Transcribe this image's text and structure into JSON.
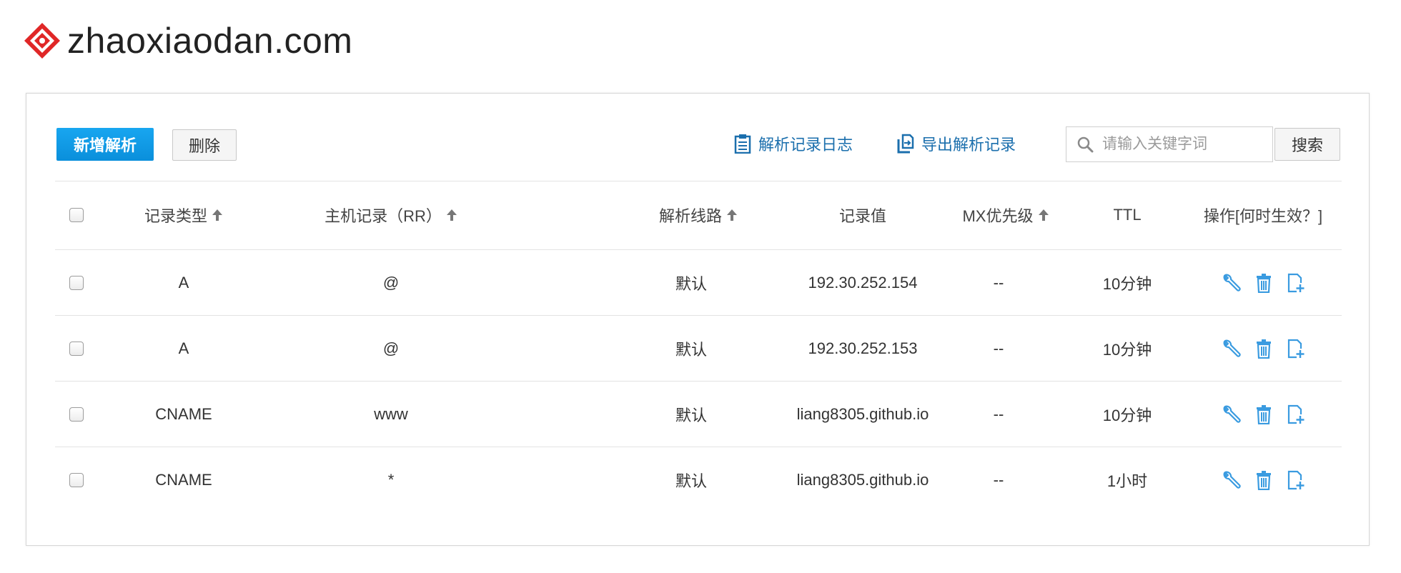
{
  "brand": {
    "name": "zhaoxiaodan.com",
    "logo_icon": "rhombus-logo-icon",
    "accent": "#e02727"
  },
  "toolbar": {
    "add_label": "新增解析",
    "delete_label": "删除",
    "log_label": "解析记录日志",
    "export_label": "导出解析记录",
    "search_placeholder": "请输入关键字词",
    "search_button": "搜索",
    "accent": "#1299e6"
  },
  "table": {
    "headers": {
      "type": "记录类型",
      "host": "主机记录（RR）",
      "line": "解析线路",
      "value": "记录值",
      "mx": "MX优先级",
      "ttl": "TTL",
      "ops": "操作[何时生效？]"
    },
    "rows": [
      {
        "type": "A",
        "host": "@",
        "line": "默认",
        "value": "192.30.252.154",
        "mx": "--",
        "ttl": "10分钟"
      },
      {
        "type": "A",
        "host": "@",
        "line": "默认",
        "value": "192.30.252.153",
        "mx": "--",
        "ttl": "10分钟"
      },
      {
        "type": "CNAME",
        "host": "www",
        "line": "默认",
        "value": "liang8305.github.io",
        "mx": "--",
        "ttl": "10分钟"
      },
      {
        "type": "CNAME",
        "host": "*",
        "line": "默认",
        "value": "liang8305.github.io",
        "mx": "--",
        "ttl": "1小时"
      }
    ],
    "row_actions": [
      "wrench-icon",
      "trash-icon",
      "add-document-icon"
    ],
    "action_color": "#3a9be0"
  }
}
